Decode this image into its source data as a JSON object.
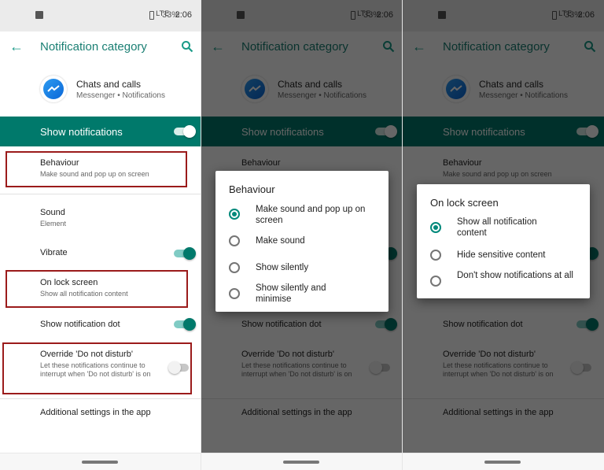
{
  "status_bar": {
    "lte": "LTE",
    "pct": "33%",
    "time": "2:06"
  },
  "app_bar": {
    "title": "Notification category"
  },
  "app": {
    "name": "Chats and calls",
    "subtitle": "Messenger • Notifications"
  },
  "show_notifications": {
    "label": "Show notifications",
    "on": true
  },
  "items": {
    "behaviour": {
      "title": "Behaviour",
      "subtitle": "Make sound and pop up on screen"
    },
    "sound": {
      "title": "Sound",
      "subtitle": "Element"
    },
    "vibrate": {
      "title": "Vibrate",
      "on": true
    },
    "lock_screen": {
      "title": "On lock screen",
      "subtitle": "Show all notification content"
    },
    "dot": {
      "title": "Show notification dot",
      "on": true
    },
    "dnd": {
      "title": "Override 'Do not disturb'",
      "subtitle": "Let these notifications continue to interrupt when 'Do not disturb' is on",
      "on": false
    },
    "additional": {
      "title": "Additional settings in the app"
    }
  },
  "behaviour_dialog": {
    "title": "Behaviour",
    "options": [
      {
        "label": "Make sound and pop up on screen",
        "selected": true
      },
      {
        "label": "Make sound",
        "selected": false
      },
      {
        "label": "Show silently",
        "selected": false
      },
      {
        "label": "Show silently and minimise",
        "selected": false
      }
    ]
  },
  "lock_dialog": {
    "title": "On lock screen",
    "options": [
      {
        "label": "Show all notification content",
        "selected": true
      },
      {
        "label": "Hide sensitive content",
        "selected": false
      },
      {
        "label": "Don't show notifications at all",
        "selected": false
      }
    ]
  },
  "colors": {
    "accent": "#00796b",
    "title_teal": "#1a7f73",
    "highlight_box": "#9b1b1b"
  },
  "icons": [
    "back-arrow-icon",
    "search-icon",
    "messenger-icon",
    "image-icon",
    "battery-icon",
    "radio-icon"
  ]
}
